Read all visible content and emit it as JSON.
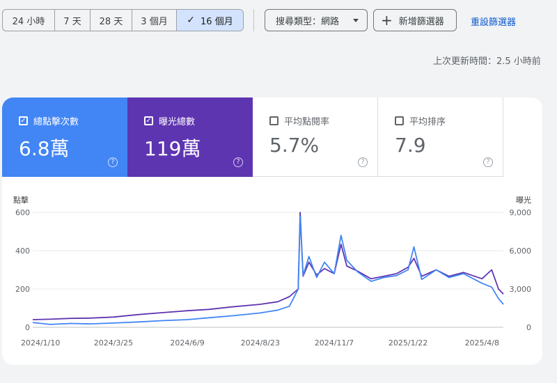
{
  "toolbar": {
    "ranges": [
      "24 小時",
      "7 天",
      "28 天",
      "3 個月",
      "16 個月"
    ],
    "active_range_check": "✓",
    "search_type": "搜尋類型：網路",
    "add_filter_icon": "+",
    "add_filter": "新增篩選器",
    "reset_filters": "重設篩選器"
  },
  "last_updated": "上次更新時間：2.5 小時前",
  "metrics": {
    "clicks": {
      "label": "總點擊次數",
      "value": "6.8萬",
      "checked": true,
      "color": "#4285f4"
    },
    "impressions": {
      "label": "曝光總數",
      "value": "119萬",
      "checked": true,
      "color": "#5e35b1"
    },
    "ctr": {
      "label": "平均點閱率",
      "value": "5.7%",
      "checked": false
    },
    "position": {
      "label": "平均排序",
      "value": "7.9",
      "checked": false
    }
  },
  "check_glyph": "✓",
  "help_glyph": "?",
  "chart_data": {
    "type": "line",
    "left_axis_label": "點擊",
    "right_axis_label": "曝光",
    "left_ticks": [
      "0",
      "200",
      "400",
      "600"
    ],
    "right_ticks": [
      "0",
      "3,000",
      "6,000",
      "9,000"
    ],
    "left_ylim": [
      0,
      600
    ],
    "right_ylim": [
      0,
      9000
    ],
    "x_tick_labels": [
      "2024/1/10",
      "2024/3/25",
      "2024/6/9",
      "2024/8/23",
      "2024/11/7",
      "2025/1/22",
      "2025/4/8"
    ],
    "x_range": [
      "2024/1/2",
      "2025/4/30"
    ],
    "grid": true,
    "series": [
      {
        "name": "總點擊次數",
        "axis": "left",
        "color": "#4285f4",
        "points": [
          [
            "2024/1/2",
            25
          ],
          [
            "2024/1/20",
            15
          ],
          [
            "2024/2/10",
            20
          ],
          [
            "2024/3/1",
            18
          ],
          [
            "2024/3/25",
            22
          ],
          [
            "2024/4/20",
            28
          ],
          [
            "2024/5/15",
            35
          ],
          [
            "2024/6/9",
            40
          ],
          [
            "2024/7/1",
            50
          ],
          [
            "2024/7/25",
            60
          ],
          [
            "2024/8/23",
            75
          ],
          [
            "2024/9/10",
            90
          ],
          [
            "2024/9/22",
            110
          ],
          [
            "2024/10/1",
            200
          ],
          [
            "2024/10/3",
            580
          ],
          [
            "2024/10/6",
            270
          ],
          [
            "2024/10/12",
            370
          ],
          [
            "2024/10/20",
            260
          ],
          [
            "2024/10/28",
            340
          ],
          [
            "2024/11/7",
            280
          ],
          [
            "2024/11/14",
            480
          ],
          [
            "2024/11/20",
            350
          ],
          [
            "2024/12/1",
            290
          ],
          [
            "2024/12/15",
            240
          ],
          [
            "2024/12/28",
            260
          ],
          [
            "2025/1/10",
            270
          ],
          [
            "2025/1/22",
            300
          ],
          [
            "2025/1/28",
            420
          ],
          [
            "2025/2/5",
            250
          ],
          [
            "2025/2/20",
            300
          ],
          [
            "2025/3/5",
            260
          ],
          [
            "2025/3/20",
            280
          ],
          [
            "2025/4/8",
            230
          ],
          [
            "2025/4/18",
            210
          ],
          [
            "2025/4/25",
            150
          ],
          [
            "2025/4/30",
            120
          ]
        ]
      },
      {
        "name": "曝光總數",
        "axis": "right",
        "color": "#5e35b1",
        "points": [
          [
            "2024/1/2",
            600
          ],
          [
            "2024/1/20",
            630
          ],
          [
            "2024/2/10",
            700
          ],
          [
            "2024/3/1",
            720
          ],
          [
            "2024/3/25",
            800
          ],
          [
            "2024/4/20",
            1000
          ],
          [
            "2024/5/15",
            1150
          ],
          [
            "2024/6/9",
            1300
          ],
          [
            "2024/7/1",
            1400
          ],
          [
            "2024/7/25",
            1600
          ],
          [
            "2024/8/23",
            1800
          ],
          [
            "2024/9/10",
            2000
          ],
          [
            "2024/9/22",
            2400
          ],
          [
            "2024/10/1",
            3000
          ],
          [
            "2024/10/3",
            9000
          ],
          [
            "2024/10/6",
            4000
          ],
          [
            "2024/10/12",
            5100
          ],
          [
            "2024/10/20",
            4100
          ],
          [
            "2024/10/28",
            4600
          ],
          [
            "2024/11/7",
            4200
          ],
          [
            "2024/11/14",
            6500
          ],
          [
            "2024/11/20",
            4800
          ],
          [
            "2024/12/1",
            4400
          ],
          [
            "2024/12/15",
            3800
          ],
          [
            "2024/12/28",
            4000
          ],
          [
            "2025/1/10",
            4200
          ],
          [
            "2025/1/22",
            4700
          ],
          [
            "2025/1/28",
            5400
          ],
          [
            "2025/2/5",
            4000
          ],
          [
            "2025/2/20",
            4500
          ],
          [
            "2025/3/5",
            4000
          ],
          [
            "2025/3/20",
            4300
          ],
          [
            "2025/4/8",
            3800
          ],
          [
            "2025/4/18",
            4500
          ],
          [
            "2025/4/25",
            3000
          ],
          [
            "2025/4/30",
            2600
          ]
        ]
      }
    ]
  }
}
